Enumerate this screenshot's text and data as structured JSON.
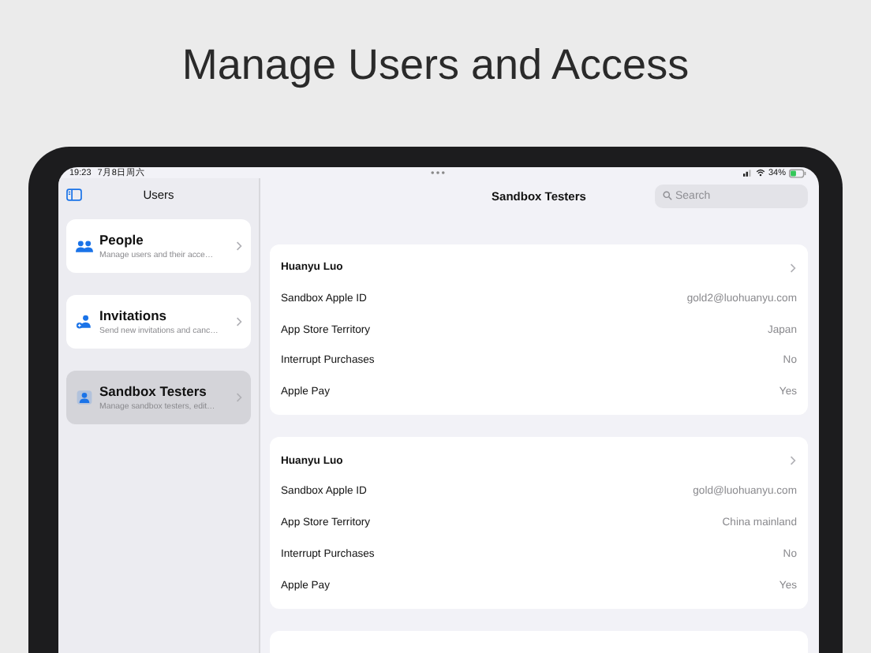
{
  "headline": "Manage Users and Access",
  "status_bar": {
    "time": "19:23",
    "date": "7月8日周六",
    "battery": "34%"
  },
  "sidebar": {
    "title": "Users",
    "items": [
      {
        "title": "People",
        "subtitle": "Manage users and their acce…",
        "selected": false,
        "kind": "people"
      },
      {
        "title": "Invitations",
        "subtitle": "Send new invitations and canc…",
        "selected": false,
        "kind": "invite"
      },
      {
        "title": "Sandbox Testers",
        "subtitle": "Manage sandbox testers, edit…",
        "selected": true,
        "kind": "person"
      }
    ]
  },
  "main": {
    "title": "Sandbox Testers",
    "search": {
      "placeholder": "Search"
    },
    "testers": [
      {
        "name": "Huanyu Luo",
        "rows": [
          {
            "label": "Sandbox Apple ID",
            "value": "gold2@luohuanyu.com"
          },
          {
            "label": "App Store Territory",
            "value": "Japan"
          },
          {
            "label": "Interrupt Purchases",
            "value": "No"
          },
          {
            "label": "Apple Pay",
            "value": "Yes"
          }
        ]
      },
      {
        "name": "Huanyu Luo",
        "rows": [
          {
            "label": "Sandbox Apple ID",
            "value": "gold@luohuanyu.com"
          },
          {
            "label": "App Store Territory",
            "value": "China mainland"
          },
          {
            "label": "Interrupt Purchases",
            "value": "No"
          },
          {
            "label": "Apple Pay",
            "value": "Yes"
          }
        ]
      }
    ],
    "more_below": true
  }
}
